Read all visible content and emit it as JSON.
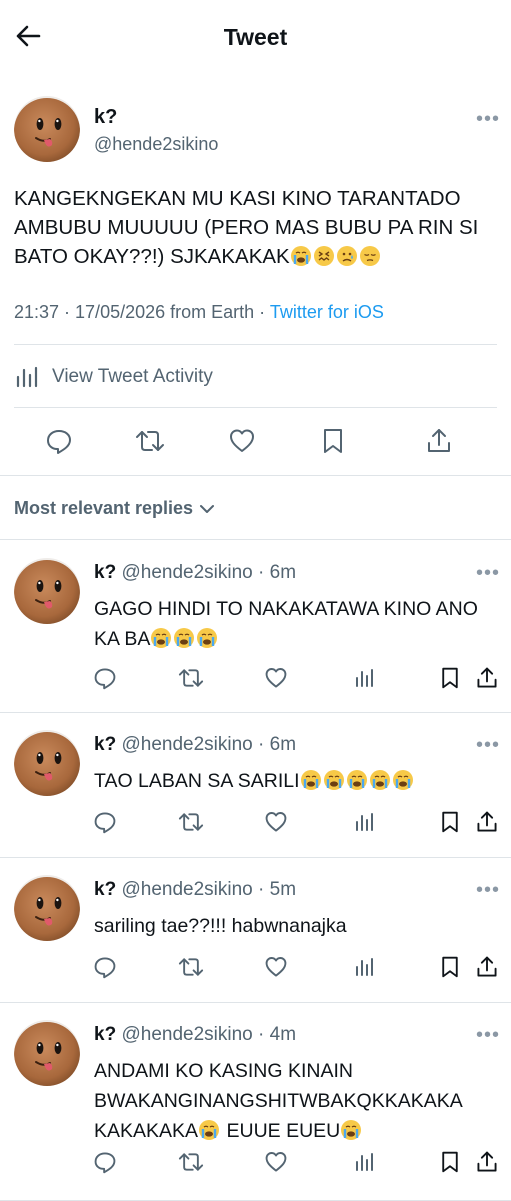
{
  "header": {
    "title": "Tweet"
  },
  "main_tweet": {
    "name": "k?",
    "handle": "@hende2sikino",
    "text": "KANGEKNGEKAN MU KASI KINO TARANTADO AMBUBU MUUUUU (PERO MAS BUBU PA RIN SI BATO OKAY??!) SJKAKAKAK",
    "emojis": [
      "loudly-crying-face",
      "confounded-face",
      "sad-relieved-face",
      "pensive-face"
    ],
    "time": "21:37 · 17/05/2026 from Earth · ",
    "source": "Twitter for iOS",
    "activity_label": "View Tweet Activity"
  },
  "sort_label": "Most relevant replies",
  "replies": [
    {
      "name": "k?",
      "handle": "@hende2sikino",
      "dot": " · ",
      "time": "6m",
      "text": "GAGO HINDI TO NAKAKATAWA KINO ANO KA BA",
      "emoji_count": 3
    },
    {
      "name": "k?",
      "handle": "@hende2sikino",
      "dot": " · ",
      "time": "6m",
      "text": "TAO LABAN SA SARILI",
      "emoji_count": 5
    },
    {
      "name": "k?",
      "handle": "@hende2sikino",
      "dot": " · ",
      "time": "5m",
      "text": "sariling tae??!!! habwnanajka",
      "emoji_count": 0
    },
    {
      "name": "k?",
      "handle": "@hende2sikino",
      "dot": " · ",
      "time": "4m",
      "text": "ANDAMI KO KASING KINAIN BWAKANGINANGSHITWBAKQKKAKAKA KAKAKAKA",
      "text_tail": " EUUE EUEU",
      "emoji_count": 1
    }
  ],
  "colors": {
    "accent": "#1d9bf0",
    "muted": "#536471",
    "divider": "#dfe4e8"
  }
}
